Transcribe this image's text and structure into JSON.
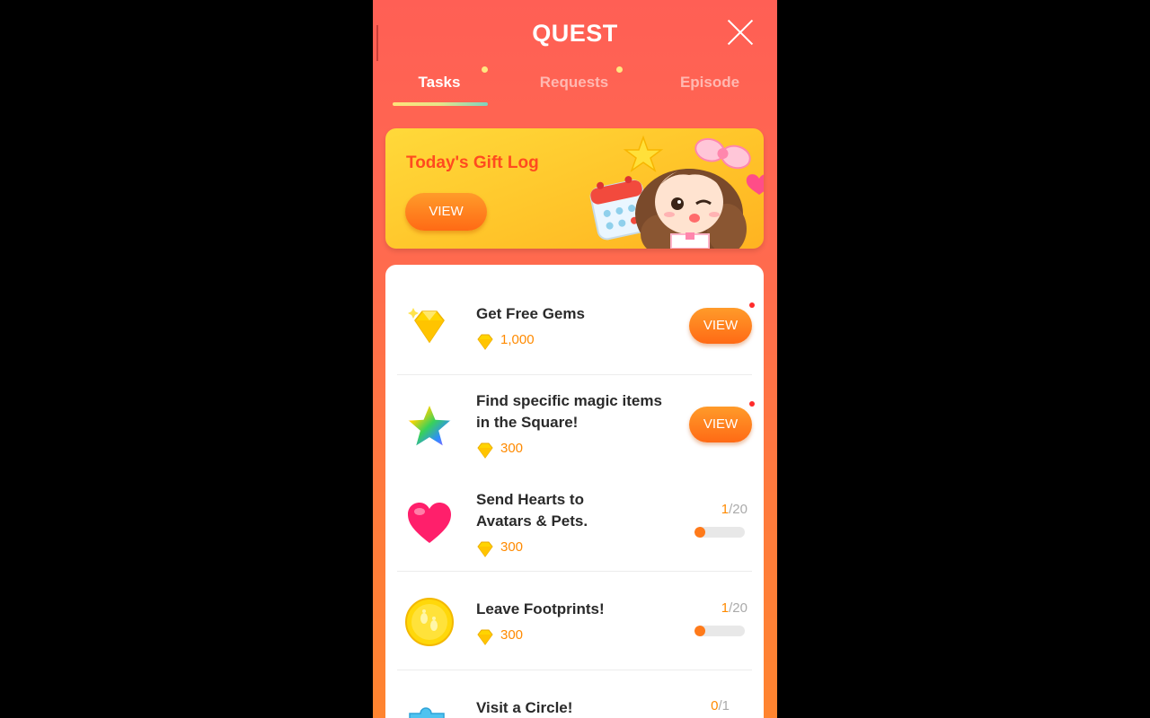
{
  "header": {
    "title": "QUEST"
  },
  "tabs": [
    {
      "label": "Tasks",
      "active": true,
      "has_dot": true
    },
    {
      "label": "Requests",
      "active": false,
      "has_dot": true
    },
    {
      "label": "Episode",
      "active": false,
      "has_dot": false
    }
  ],
  "gift_log": {
    "title": "Today's Gift Log",
    "button": "VIEW"
  },
  "tasks": [
    {
      "icon": "diamond-gem-icon",
      "name": "Get Free Gems",
      "reward": "1,000",
      "action": "VIEW",
      "new": true
    },
    {
      "icon": "rainbow-star-icon",
      "name": "Find specific magic items in the Square!",
      "reward": "300",
      "action": "VIEW",
      "new": true
    },
    {
      "icon": "heart-icon",
      "name": "Send Hearts to Avatars & Pets.",
      "reward": "300",
      "progress_current": "1",
      "progress_total": "/20",
      "progress_fraction": 0.05
    },
    {
      "icon": "footprint-coin-icon",
      "name": "Leave Footprints!",
      "reward": "300",
      "progress_current": "1",
      "progress_total": "/20",
      "progress_fraction": 0.05
    },
    {
      "icon": "circle-puzzle-icon",
      "name": "Visit a Circle!",
      "progress_current": "0",
      "progress_total": "/1"
    }
  ],
  "colors": {
    "accent": "#ff6a15",
    "reward": "#ff8a00",
    "header_bg": "#ff5f55"
  }
}
